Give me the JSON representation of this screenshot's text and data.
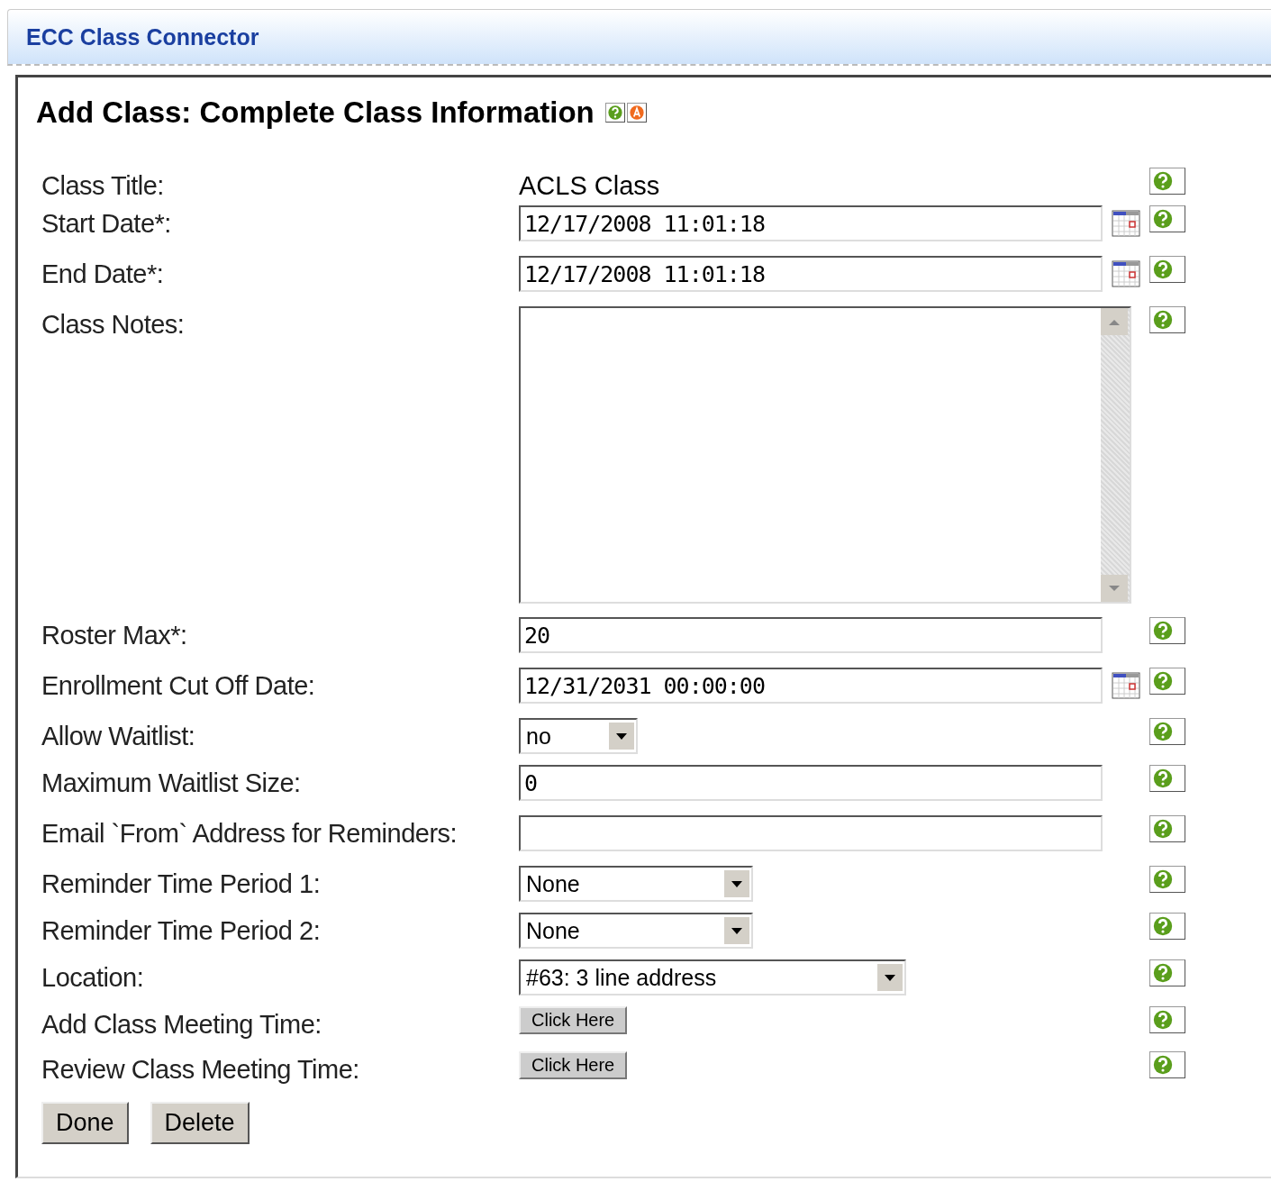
{
  "header": {
    "title": "ECC Class Connector"
  },
  "page": {
    "title": "Add Class: Complete Class Information"
  },
  "rows": [
    {
      "label": "Class Title:",
      "kind": "text",
      "value": "ACLS Class"
    },
    {
      "label": "Start Date*:",
      "kind": "date",
      "value": "12/17/2008 11:01:18"
    },
    {
      "label": "End Date*:",
      "kind": "date",
      "value": "12/17/2008 11:01:18"
    },
    {
      "label": "Class Notes:",
      "kind": "textarea"
    },
    {
      "label": "Roster Max*:",
      "kind": "input",
      "value": "20"
    },
    {
      "label": "Enrollment Cut Off Date:",
      "kind": "date",
      "value": "12/31/2031 00:00:00"
    },
    {
      "label": "Allow Waitlist:",
      "kind": "select",
      "value": "no"
    },
    {
      "label": "Maximum Waitlist Size:",
      "kind": "input",
      "value": "0"
    },
    {
      "label": "Email `From` Address for Reminders:",
      "kind": "input"
    },
    {
      "label": "Reminder Time Period 1:",
      "kind": "select",
      "value": "None"
    },
    {
      "label": "Reminder Time Period 2:",
      "kind": "select",
      "value": "None"
    },
    {
      "label": "Location:",
      "kind": "select",
      "value": "#63: 3 line address"
    },
    {
      "label": "Add Class Meeting Time:",
      "kind": "button",
      "value": "Click Here"
    },
    {
      "label": "Review Class Meeting Time:",
      "kind": "button",
      "value": "Click Here"
    }
  ],
  "buttons": [
    "Done",
    "Delete"
  ]
}
